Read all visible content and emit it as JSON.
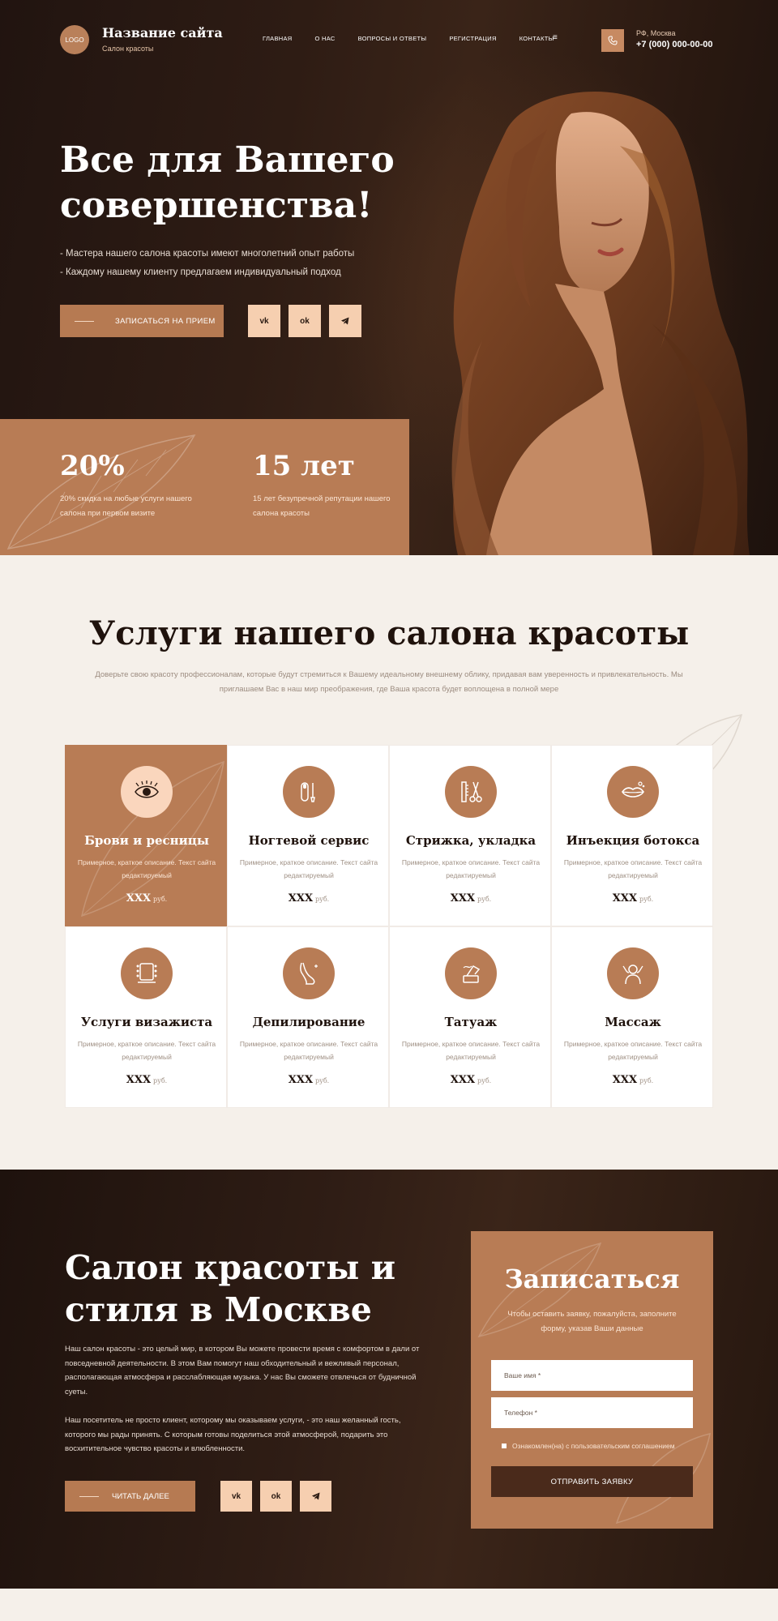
{
  "header": {
    "logo": "LOGO",
    "site_name": "Название сайта",
    "site_sub": "Салон красоты",
    "nav": [
      "ГЛАВНАЯ",
      "О НАС",
      "ВОПРОСЫ И ОТВЕТЫ",
      "РЕГИСТРАЦИЯ",
      "КОНТАКТЫ"
    ],
    "menu_icon": "≡",
    "city": "РФ, Москва",
    "phone": "+7 (000) 000-00-00"
  },
  "hero": {
    "title": "Все для Вашего совершенства!",
    "bullets": [
      "- Мастера нашего салона красоты имеют многолетний опыт работы",
      "- Каждому нашему клиенту предлагаем индивидуальный подход"
    ],
    "cta": "ЗАПИСАТЬСЯ НА ПРИЕМ",
    "social": [
      "vk-icon",
      "ok-icon",
      "telegram-icon"
    ]
  },
  "stats": [
    {
      "num": "20%",
      "text": "20% скидка на любые услуги нашего салона при первом визите"
    },
    {
      "num": "15 лет",
      "text": "15 лет безупречной репутации нашего салона красоты"
    }
  ],
  "services": {
    "title": "Услуги нашего салона красоты",
    "desc": "Доверьте свою красоту профессионалам, которые будут стремиться к Вашему идеальному внешнему облику, придавая вам уверенность и привлекательность. Мы приглашаем Вас в наш мир преображения, где Ваша красота будет воплощена в полной мере",
    "items": [
      {
        "name": "Брови и ресницы",
        "desc": "Примерное, краткое описание. Текст сайта редактируемый",
        "price": "XXX",
        "unit": "руб.",
        "icon": "eye-lash-icon",
        "active": true
      },
      {
        "name": "Ногтевой сервис",
        "desc": "Примерное, краткое описание. Текст сайта редактируемый",
        "price": "XXX",
        "unit": "руб.",
        "icon": "nail-icon",
        "active": false
      },
      {
        "name": "Стрижка, укладка",
        "desc": "Примерное, краткое описание. Текст сайта редактируемый",
        "price": "XXX",
        "unit": "руб.",
        "icon": "scissors-comb-icon",
        "active": false
      },
      {
        "name": "Инъекция ботокса",
        "desc": "Примерное, краткое описание. Текст сайта редактируемый",
        "price": "XXX",
        "unit": "руб.",
        "icon": "lips-icon",
        "active": false
      },
      {
        "name": "Услуги визажиста",
        "desc": "Примерное, краткое описание. Текст сайта редактируемый",
        "price": "XXX",
        "unit": "руб.",
        "icon": "mirror-icon",
        "active": false
      },
      {
        "name": "Депилирование",
        "desc": "Примерное, краткое описание. Текст сайта редактируемый",
        "price": "XXX",
        "unit": "руб.",
        "icon": "leg-icon",
        "active": false
      },
      {
        "name": "Татуаж",
        "desc": "Примерное, краткое описание. Текст сайта редактируемый",
        "price": "XXX",
        "unit": "руб.",
        "icon": "tattoo-machine-icon",
        "active": false
      },
      {
        "name": "Массаж",
        "desc": "Примерное, краткое описание. Текст сайта редактируемый",
        "price": "XXX",
        "unit": "руб.",
        "icon": "massage-icon",
        "active": false
      }
    ]
  },
  "about": {
    "title": "Салон красоты и стиля в Москве",
    "p1": "Наш салон красоты - это целый мир, в котором Вы можете провести время с комфортом в дали от повседневной деятельности. В этом Вам помогут наш обходительный и вежливый персонал, располагающая атмосфера и расслабляющая музыка. У нас Вы сможете отвлечься от будничной суеты.",
    "p2": "Наш посетитель не просто клиент, которому мы оказываем услуги, - это наш желанный гость, которого мы рады принять. С которым готовы поделиться этой атмосферой, подарить это восхитительное чувство красоты и влюбленности.",
    "cta": "ЧИТАТЬ ДАЛЕЕ"
  },
  "form": {
    "title": "Записаться",
    "sub": "Чтобы оставить заявку, пожалуйста, заполните форму, указав Ваши данные",
    "name_placeholder": "Ваше имя *",
    "phone_placeholder": "Телефон *",
    "agree": "Ознакомлен(на) с пользовательским соглашением",
    "submit": "ОТПРАВИТЬ ЗАЯВКУ"
  },
  "colors": {
    "accent": "#b87c55",
    "dark": "#2a1a12",
    "light": "#f5f0ea",
    "soft": "#f6cfb0"
  }
}
